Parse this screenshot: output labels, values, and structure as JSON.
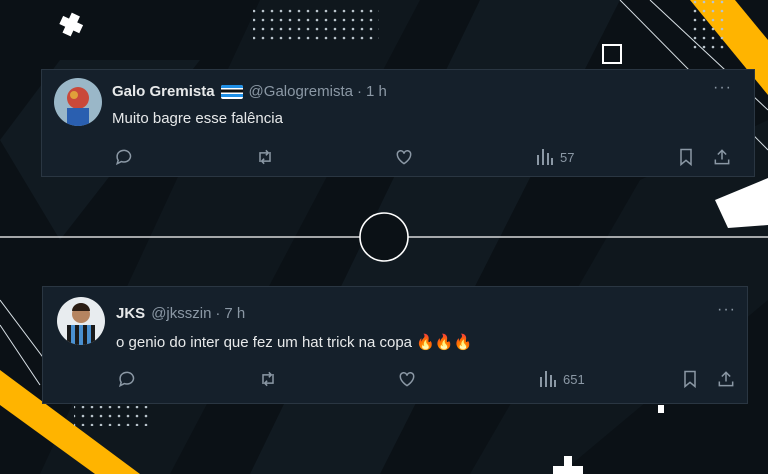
{
  "colors": {
    "accent": "#ffb400",
    "background": "#0b1116",
    "card": "#15202b",
    "muted": "#8b98a5"
  },
  "tweets": [
    {
      "name": "Galo Gremista",
      "handle": "@Galogremista",
      "separator": "·",
      "time": "1 h",
      "text": "Muito bagre esse falência",
      "views": "57",
      "more": "···",
      "icons": [
        "reply-icon",
        "retweet-icon",
        "like-icon",
        "views-icon",
        "bookmark-icon",
        "share-icon"
      ]
    },
    {
      "name": "JKS",
      "handle": "@jksszin",
      "separator": "·",
      "time": "7 h",
      "text": "o genio do inter que fez um hat trick na copa 🔥🔥🔥",
      "views": "651",
      "more": "···",
      "icons": [
        "reply-icon",
        "retweet-icon",
        "like-icon",
        "views-icon",
        "bookmark-icon",
        "share-icon"
      ]
    }
  ]
}
